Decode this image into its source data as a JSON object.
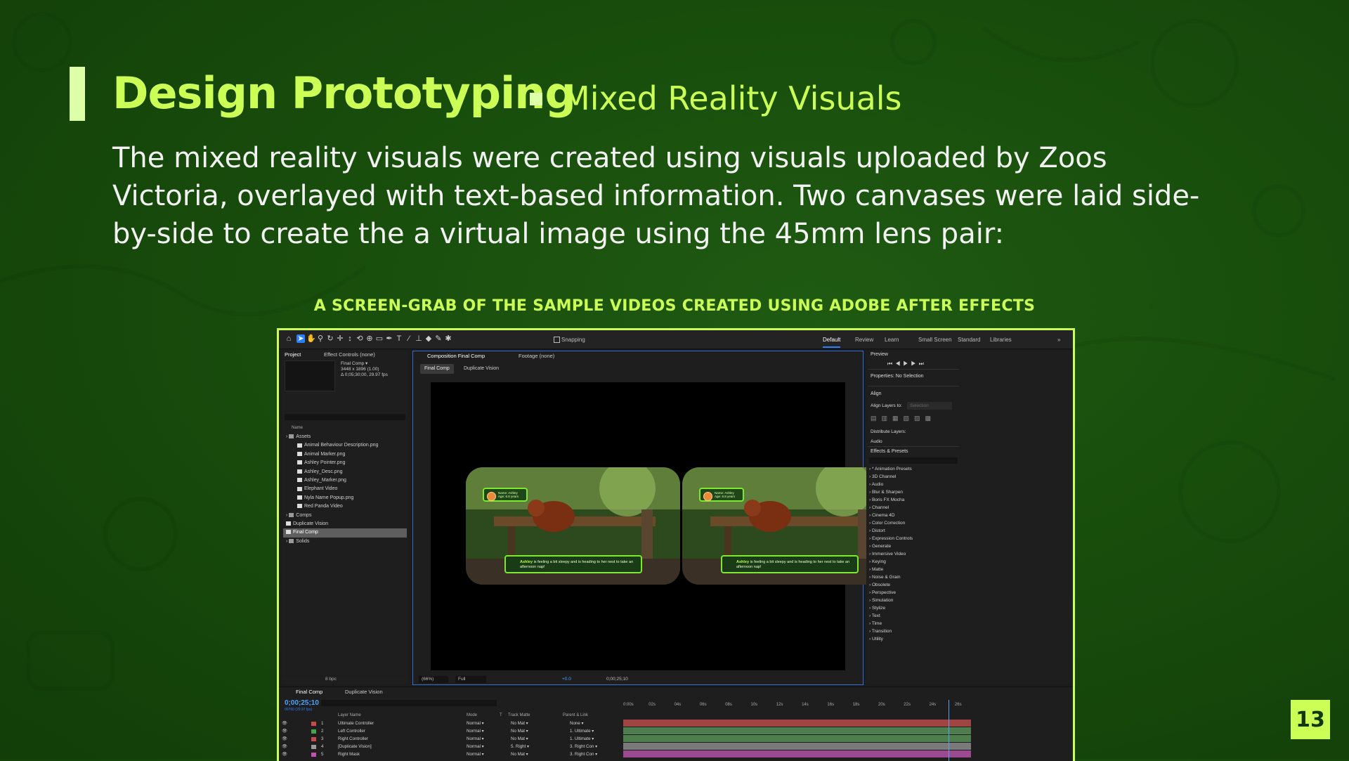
{
  "slide": {
    "title": "Design Prototyping",
    "subtitle": "Mixed Reality Visuals",
    "body": "The mixed reality visuals were created using visuals uploaded by Zoos Victoria, overlayed with text-based information. Two canvases were laid side-by-side to create the a virtual image using the 45mm lens pair:",
    "caption": "A SCREEN-GRAB OF THE SAMPLE VIDEOS CREATED USING ADOBE AFTER EFFECTS",
    "page_number": "13",
    "colors": {
      "accent": "#ccff55",
      "background": "#184d0c",
      "page_badge": "#ccff55"
    }
  },
  "app": {
    "toolbar": {
      "snapping_label": "Snapping",
      "workspaces": [
        "Default",
        "Review",
        "Learn",
        "Small Screen",
        "Standard",
        "Libraries"
      ],
      "active_workspace": "Default",
      "tool_icons": [
        "home-icon",
        "selection-tool-icon",
        "hand-tool-icon",
        "zoom-tool-icon",
        "orbit-camera-icon",
        "pan-camera-icon",
        "dolly-camera-icon",
        "rotate-tool-icon",
        "anchor-point-tool-icon",
        "shape-tool-icon",
        "pen-tool-icon",
        "type-tool-icon",
        "brush-tool-icon",
        "clone-stamp-icon",
        "eraser-icon",
        "roto-brush-icon",
        "puppet-pin-icon"
      ]
    },
    "project_panel": {
      "tab_project": "Project",
      "tab_effect_controls": "Effect Controls (none)",
      "selected_item": "Final Comp ▾",
      "selected_meta_1": "3448 x 1896 (1.00)",
      "selected_meta_2": "Δ 0;05;30;00, 29.97 fps",
      "name_header": "Name",
      "tree": [
        {
          "label": "Assets",
          "type": "folder",
          "indent": 0
        },
        {
          "label": "Animal Behaviour Description.png",
          "type": "file",
          "indent": 1
        },
        {
          "label": "Animal Marker.png",
          "type": "file",
          "indent": 1
        },
        {
          "label": "Ashley Pointer.png",
          "type": "file",
          "indent": 1
        },
        {
          "label": "Ashley_Desc.png",
          "type": "file",
          "indent": 1
        },
        {
          "label": "Ashley_Marker.png",
          "type": "file",
          "indent": 1
        },
        {
          "label": "Elephant Video",
          "type": "file",
          "indent": 1
        },
        {
          "label": "Nyla Name Popup.png",
          "type": "file",
          "indent": 1
        },
        {
          "label": "Red Panda Video",
          "type": "file",
          "indent": 1
        },
        {
          "label": "Comps",
          "type": "folder",
          "indent": 0
        },
        {
          "label": "Duplicate Vision",
          "type": "comp",
          "indent": 0
        },
        {
          "label": "Final Comp",
          "type": "comp",
          "indent": 0,
          "selected": true
        },
        {
          "label": "Solids",
          "type": "folder",
          "indent": 0
        }
      ],
      "bpc": "8 bpc"
    },
    "composition": {
      "tab_label": "Composition Final Comp",
      "footage_tab": "Footage (none)",
      "subtab_active": "Final Comp",
      "subtab_other": "Duplicate Vision",
      "zoom": "(66%)",
      "resolution": "Full",
      "exposure": "+0.0",
      "timecode": "0;00;25;10",
      "overlay_name_line1": "Name: Ashley",
      "overlay_name_line2": "Age: 6.8 years",
      "overlay_info_name": "Ashley",
      "overlay_info_text": " is feeling a bit sleepy and is heading to her nest to take an afternoon nap!"
    },
    "right_panel": {
      "preview": "Preview",
      "properties": "Properties: No Selection",
      "align": "Align",
      "align_layers_to": "Align Layers to:",
      "align_target": "Selection",
      "distribute_layers": "Distribute Layers:",
      "audio": "Audio",
      "effects_presets": "Effects & Presets",
      "effect_categories": [
        "* Animation Presets",
        "3D Channel",
        "Audio",
        "Blur & Sharpen",
        "Boris FX Mocha",
        "Channel",
        "Cinema 4D",
        "Color Correction",
        "Distort",
        "Expression Controls",
        "Generate",
        "Immersive Video",
        "Keying",
        "Matte",
        "Noise & Grain",
        "Obsolete",
        "Perspective",
        "Simulation",
        "Stylize",
        "Text",
        "Time",
        "Transition",
        "Utility"
      ]
    },
    "timeline": {
      "tab_active": "Final Comp",
      "tab_other": "Duplicate Vision",
      "timecode": "0;00;25;10",
      "timecode_sub": "00760 (29.97 fps)",
      "col_layer_name": "Layer Name",
      "col_mode": "Mode",
      "col_t": "T",
      "col_track_matte": "Track Matte",
      "col_parent": "Parent & Link",
      "ruler": [
        "0:00s",
        "02s",
        "04s",
        "06s",
        "08s",
        "10s",
        "12s",
        "14s",
        "16s",
        "18s",
        "20s",
        "22s",
        "24s",
        "26s"
      ],
      "layers": [
        {
          "num": "1",
          "name": "Ultimate Controller",
          "mode": "Normal",
          "matte": "No Mat",
          "parent": "None",
          "color": "#c84a4a",
          "bar": "#a14444"
        },
        {
          "num": "2",
          "name": "Left Controller",
          "mode": "Normal",
          "matte": "No Mat",
          "parent": "1. Ultimate",
          "color": "#4aa34a",
          "bar": "#4e7d4e"
        },
        {
          "num": "3",
          "name": "Right Controller",
          "mode": "Normal",
          "matte": "No Mat",
          "parent": "1. Ultimate",
          "color": "#c84a4a",
          "bar": "#4e7d4e"
        },
        {
          "num": "4",
          "name": "[Duplicate Vision]",
          "mode": "Normal",
          "matte": "5. Right",
          "parent": "3. Right Con",
          "color": "#9a9a9a",
          "bar": "#7a7a7a"
        },
        {
          "num": "5",
          "name": "Right Mask",
          "mode": "Normal",
          "matte": "No Mat",
          "parent": "3. Right Con",
          "color": "#c64fb4",
          "bar": "#9b4a90"
        }
      ]
    }
  }
}
